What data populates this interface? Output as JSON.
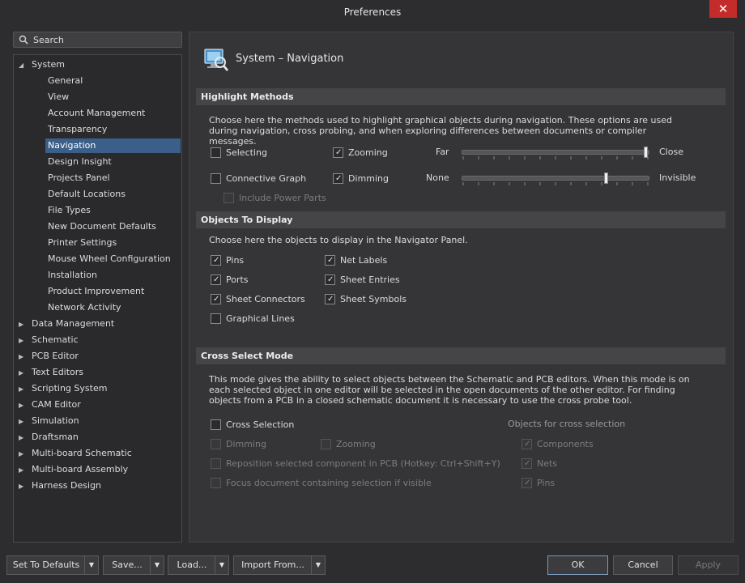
{
  "window": {
    "title": "Preferences",
    "close_glyph": "✕"
  },
  "search": {
    "placeholder": "Search"
  },
  "tree": {
    "expanded_arrow": "◢",
    "collapsed_arrow": "▶",
    "system_label": "System",
    "system_children": [
      "General",
      "View",
      "Account Management",
      "Transparency",
      "Navigation",
      "Design Insight",
      "Projects Panel",
      "Default Locations",
      "File Types",
      "New Document Defaults",
      "Printer Settings",
      "Mouse Wheel Configuration",
      "Installation",
      "Product Improvement",
      "Network Activity"
    ],
    "selected": "Navigation",
    "other_items": [
      "Data Management",
      "Schematic",
      "PCB Editor",
      "Text Editors",
      "Scripting System",
      "CAM Editor",
      "Simulation",
      "Draftsman",
      "Multi-board Schematic",
      "Multi-board Assembly",
      "Harness Design"
    ]
  },
  "page": {
    "title": "System – Navigation",
    "icon": "navigation-page-icon"
  },
  "highlight": {
    "heading": "Highlight Methods",
    "description": "Choose here the methods used to highlight graphical objects during navigation. These options are used during navigation, cross probing, and when exploring differences between documents or compiler messages.",
    "selecting": {
      "label": "Selecting",
      "checked": false
    },
    "zooming": {
      "label": "Zooming",
      "checked": true
    },
    "connective_graph": {
      "label": "Connective Graph",
      "checked": false
    },
    "dimming": {
      "label": "Dimming",
      "checked": true
    },
    "include_power_parts": {
      "label": "Include Power Parts",
      "checked": false,
      "enabled": false
    },
    "zoom_slider": {
      "min_label": "Far",
      "max_label": "Close",
      "value": 1.0
    },
    "dim_slider": {
      "min_label": "None",
      "max_label": "Invisible",
      "value": 0.78
    }
  },
  "objects": {
    "heading": "Objects To Display",
    "description": "Choose here the objects to display in the Navigator Panel.",
    "items": [
      {
        "label": "Pins",
        "checked": true
      },
      {
        "label": "Ports",
        "checked": true
      },
      {
        "label": "Sheet Connectors",
        "checked": true
      },
      {
        "label": "Graphical Lines",
        "checked": false
      },
      {
        "label": "Net Labels",
        "checked": true
      },
      {
        "label": "Sheet Entries",
        "checked": true
      },
      {
        "label": "Sheet Symbols",
        "checked": true
      }
    ]
  },
  "cross_select": {
    "heading": "Cross Select Mode",
    "description": "This mode gives the ability to select objects between the Schematic and PCB editors.  When this mode is on each selected object in one editor will be selected in the open documents of the other editor.  For finding objects from a PCB in a closed schematic document it is necessary to use the cross probe tool.",
    "cross_selection": {
      "label": "Cross Selection",
      "checked": false
    },
    "dimming": {
      "label": "Dimming",
      "checked": false
    },
    "zooming": {
      "label": "Zooming",
      "checked": false
    },
    "reposition": {
      "label": "Reposition selected component in PCB (Hotkey: Ctrl+Shift+Y)",
      "checked": false
    },
    "focus": {
      "label": "Focus document containing selection if visible",
      "checked": false
    },
    "objects_heading": "Objects for cross selection",
    "components": {
      "label": "Components",
      "checked": true
    },
    "nets": {
      "label": "Nets",
      "checked": true
    },
    "pins": {
      "label": "Pins",
      "checked": true
    }
  },
  "footer": {
    "set_to_defaults": "Set To Defaults",
    "save": "Save...",
    "load": "Load...",
    "import_from": "Import From...",
    "dropdown_glyph": "▼",
    "ok": "OK",
    "cancel": "Cancel",
    "apply": "Apply"
  },
  "colors": {
    "selection": "#3c5f8a",
    "close_button": "#c42b2b",
    "background": "#2d2d30"
  }
}
